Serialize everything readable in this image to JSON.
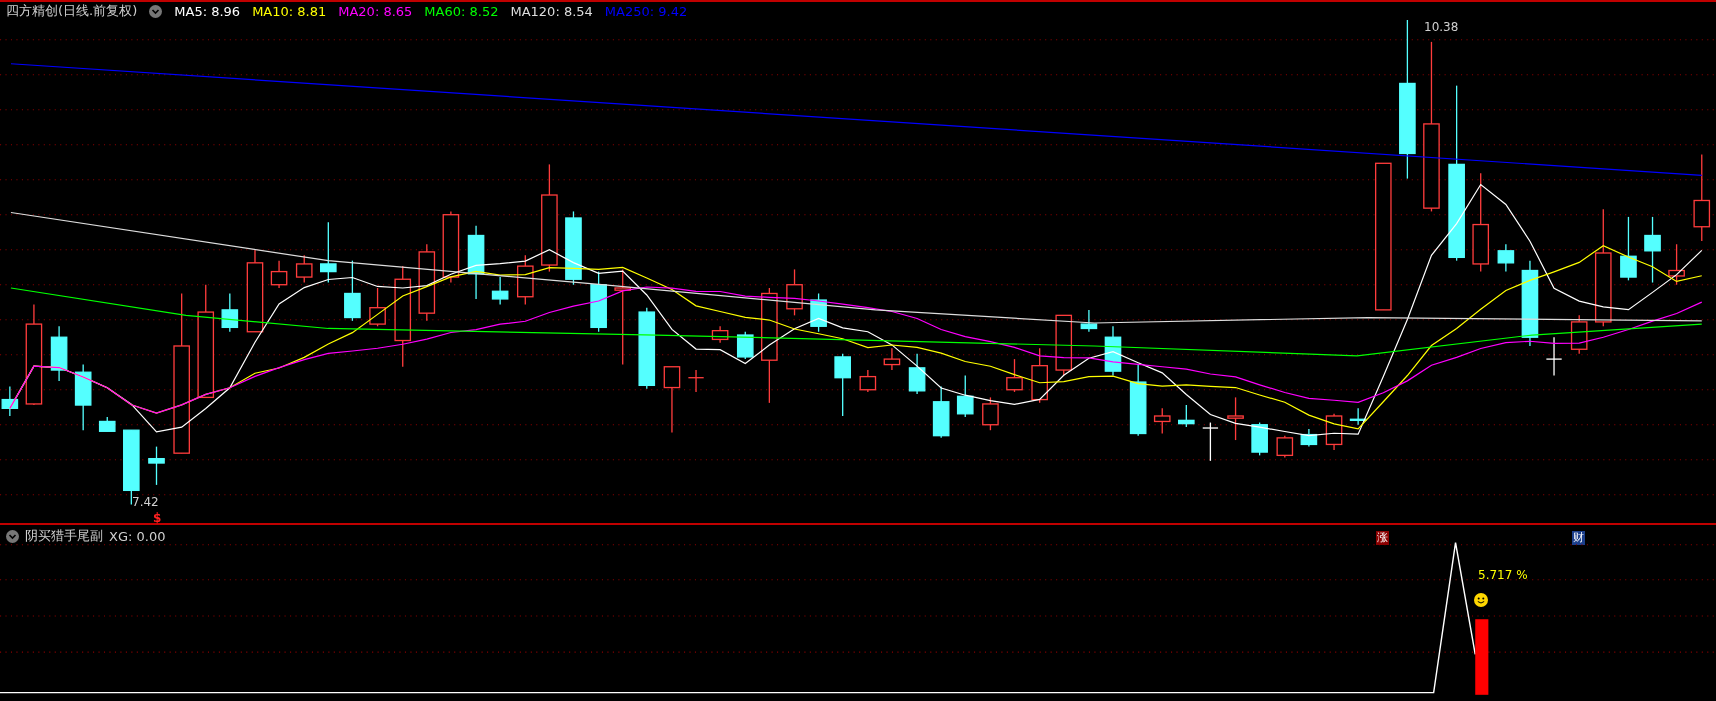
{
  "header": {
    "title": "四方精创(日线.前复权)",
    "indicators": [
      {
        "label": "MA5: 8.96",
        "color": "#ffffff"
      },
      {
        "label": "MA10: 8.81",
        "color": "#ffff00"
      },
      {
        "label": "MA20: 8.65",
        "color": "#ff00ff"
      },
      {
        "label": "MA60: 8.52",
        "color": "#00ff00"
      },
      {
        "label": "MA120: 8.54",
        "color": "#dddddd"
      },
      {
        "label": "MA250: 9.42",
        "color": "#0000ff"
      }
    ]
  },
  "price_chart": {
    "high_label": "10.38",
    "low_label": "7.42",
    "markers": [
      {
        "text": "$",
        "kind": "signal"
      },
      {
        "text": "涨",
        "kind": "badge",
        "color": "#8b0000"
      },
      {
        "text": "财",
        "kind": "badge",
        "color": "#1c3f8c"
      }
    ]
  },
  "indicator_panel": {
    "title": "阴买猎手尾副",
    "reading": "XG: 0.00",
    "annotation": "5.717 %"
  }
}
